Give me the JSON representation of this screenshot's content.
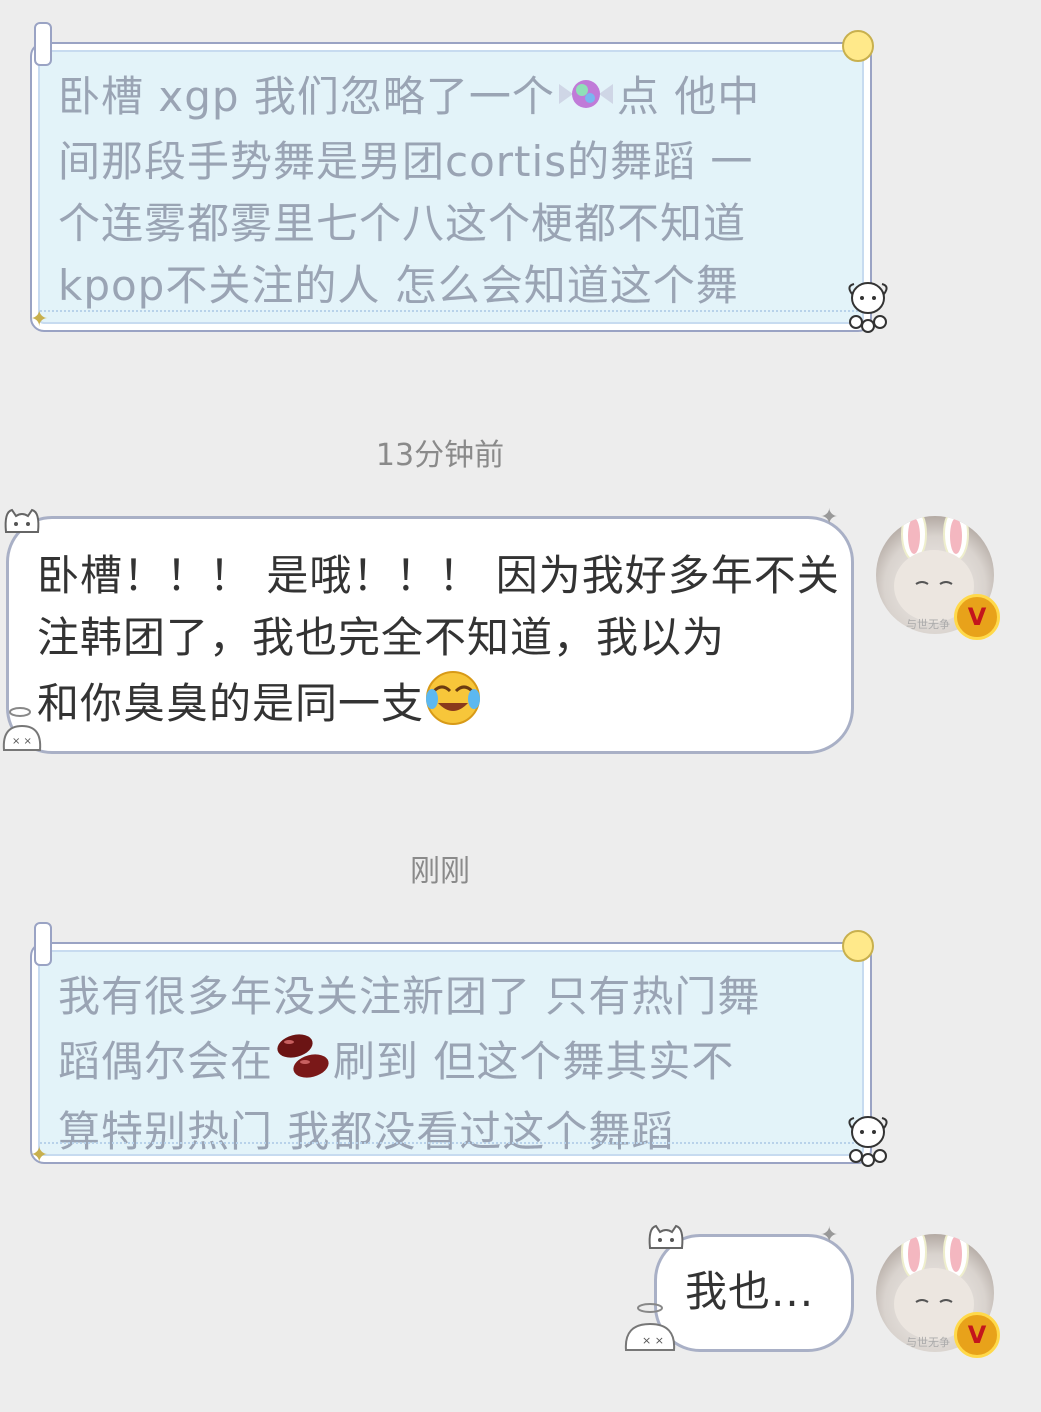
{
  "messages": [
    {
      "text": "卧槽 xgp 我们忽略了一个🍬点 他中间那段手势舞是男团cortis的舞蹈 一个连雾都雾里七个八这个梗都不知道kpop不关注的人 怎么会知道这个舞"
    },
    {
      "time": "13分钟前"
    },
    {
      "line1": "卧槽！！！ 是哦！！！ 因为我好多年不关",
      "line2": "注韩团了，我也完全不知道，我以为",
      "line3": "和你臭臭的是同一支"
    },
    {
      "time": "刚刚"
    },
    {
      "line1": "我有很多年没关注新团了 只有热门舞",
      "line2_a": "蹈偶尔会在",
      "line2_b": "刷到 但这个舞其实不",
      "line3": "算特别热门 我都没看过这个舞蹈"
    },
    {
      "text": "我也..."
    }
  ],
  "msg1": {
    "line1_a": "卧槽 xgp 我们忽略了一个",
    "line1_b": "点 他中",
    "line2": "间那段手势舞是男团cortis的舞蹈 一",
    "line3": "个连雾都雾里七个八这个梗都不知道",
    "line4": "kpop不关注的人 怎么会知道这个舞"
  },
  "avatar": {
    "badge": "V",
    "caption": "与世无争"
  },
  "colors": {
    "background": "#ededed",
    "deco_fill": "#e3f3f9",
    "deco_text": "#9aa4b4",
    "plain_border": "#a9b0c6"
  }
}
